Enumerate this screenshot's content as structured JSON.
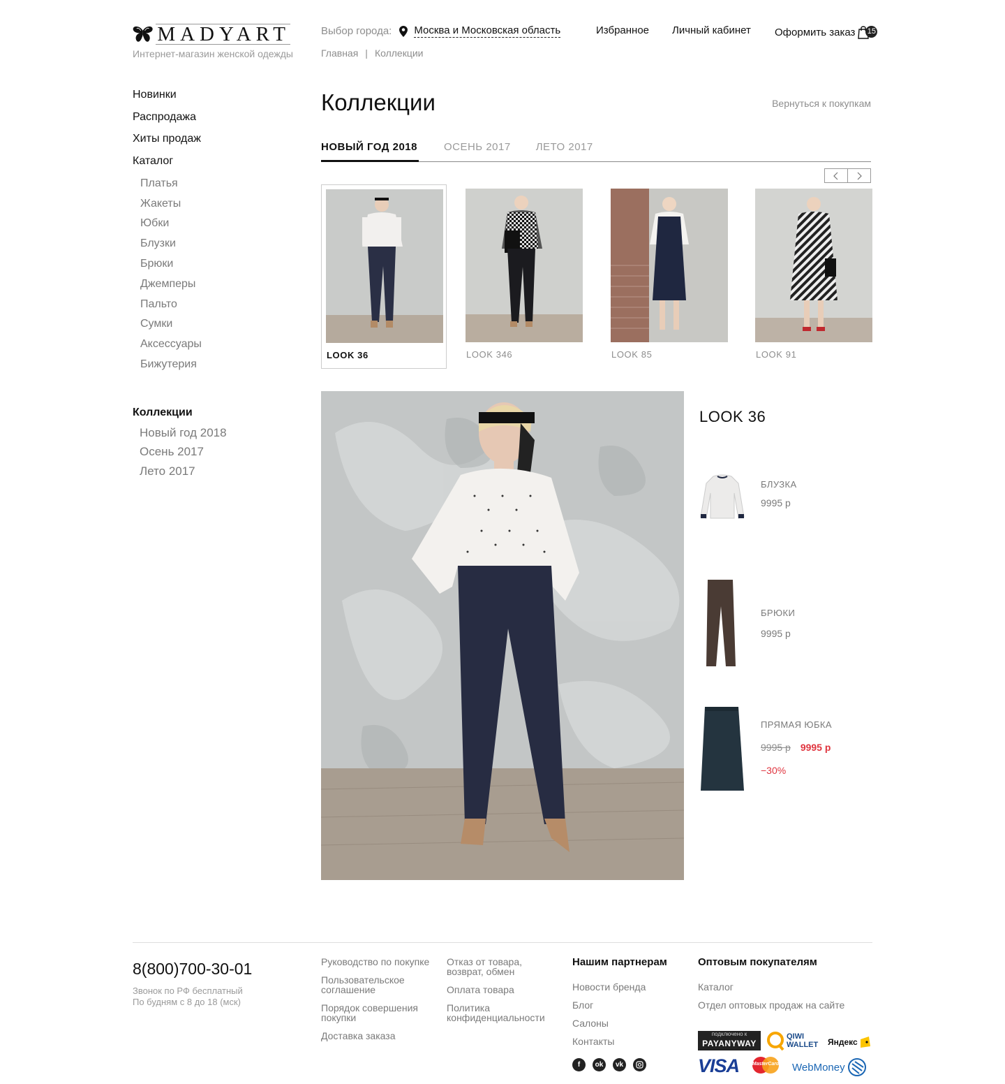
{
  "header": {
    "logo_text": "MADYART",
    "tagline": "Интернет-магазин женской одежды",
    "city_label": "Выбор города:",
    "city_value": "Москва и Московская область",
    "nav": {
      "favorites": "Избранное",
      "cabinet": "Личный кабинет",
      "order": "Оформить заказ",
      "cart_count": "15"
    },
    "breadcrumb": {
      "home": "Главная",
      "sep": "|",
      "current": "Коллекции"
    }
  },
  "sidebar": {
    "main": [
      "Новинки",
      "Распродажа",
      "Хиты продаж",
      "Каталог"
    ],
    "catalog": [
      "Платья",
      "Жакеты",
      "Юбки",
      "Блузки",
      "Брюки",
      "Джемперы",
      "Пальто",
      "Сумки",
      "Аксессуары",
      "Бижутерия"
    ],
    "collections_title": "Коллекции",
    "collections": [
      "Новый год 2018",
      "Осень 2017",
      "Лето 2017"
    ]
  },
  "main": {
    "title": "Коллекции",
    "back": "Вернуться к покупкам",
    "tabs": [
      "НОВЫЙ ГОД 2018",
      "ОСЕНЬ 2017",
      "ЛЕТО 2017"
    ],
    "looks": [
      "LOOK 36",
      "LOOK 346",
      "LOOK 85",
      "LOOK 91"
    ],
    "current_look": "LOOK 36",
    "products": [
      {
        "name": "БЛУЗКА",
        "price": "9995 р"
      },
      {
        "name": "БРЮКИ",
        "price": "9995 р"
      },
      {
        "name": "ПРЯМАЯ ЮБКА",
        "old_price": "9995 р",
        "price": "9995 р",
        "discount": "−30%"
      }
    ]
  },
  "footer": {
    "phone": "8(800)700-30-01",
    "phone_note_1": "Звонок по РФ бесплатный",
    "phone_note_2": "По будням с 8 до 18 (мск)",
    "col1": [
      "Руководство по покупке",
      "Пользовательское соглашение",
      "Порядок совершения покупки",
      "Доставка заказа"
    ],
    "col2": [
      "Отказ от товара, возврат, обмен",
      "Оплата товара",
      "Политика конфиденциальности"
    ],
    "col3_title": "Нашим партнерам",
    "col3": [
      "Новости бренда",
      "Блог",
      "Салоны",
      "Контакты"
    ],
    "col4_title": "Оптовым покупателям",
    "col4": [
      "Каталог",
      "Отдел оптовых продаж на сайте"
    ],
    "payments": {
      "payanyway_top": "подключено к",
      "payanyway": "PAYANYWAY",
      "qiwi": "QIWI WALLET",
      "yandex": "Яндекс",
      "visa": "VISA",
      "mastercard": "MasterCard",
      "webmoney": "WebMoney"
    }
  },
  "colors": {
    "accent_red": "#e0353f",
    "text_dark": "#111111",
    "text_gray": "#8d8d8d"
  }
}
